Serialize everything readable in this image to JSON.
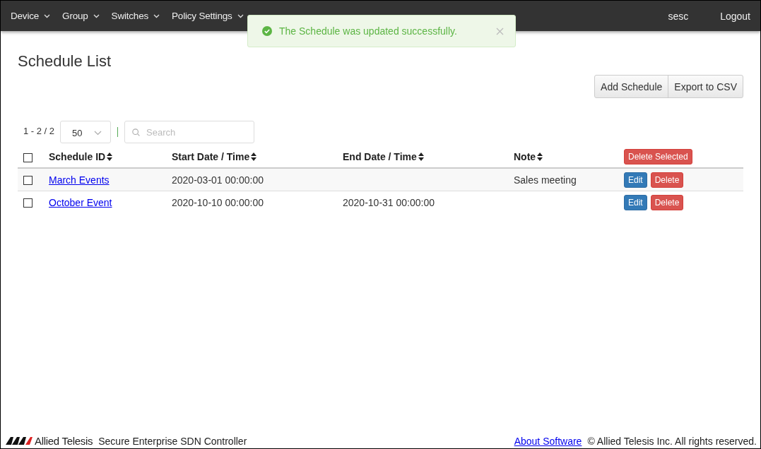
{
  "nav": {
    "items": [
      {
        "label": "Device"
      },
      {
        "label": "Group"
      },
      {
        "label": "Switches"
      },
      {
        "label": "Policy Settings"
      }
    ],
    "user": "sesc",
    "logout": "Logout"
  },
  "toast": {
    "message": "The Schedule was updated successfully."
  },
  "page": {
    "title": "Schedule List",
    "buttons": [
      "Add Schedule",
      "Export to CSV"
    ]
  },
  "pager": {
    "range": "1 - 2 / 2",
    "page_size": "50",
    "search_placeholder": "Search"
  },
  "table": {
    "columns": [
      "Schedule ID",
      "Start Date / Time",
      "End Date / Time",
      "Note"
    ],
    "delete_selected": "Delete Selected",
    "select_all_checked": false,
    "rows": [
      {
        "checked": false,
        "id": "March Events",
        "start": "2020-03-01 00:00:00",
        "end": "",
        "note": "Sales meeting",
        "edit": "Edit",
        "delete": "Delete"
      },
      {
        "checked": false,
        "id": "October Event",
        "start": "2020-10-10 00:00:00",
        "end": "2020-10-31 00:00:00",
        "note": "",
        "edit": "Edit",
        "delete": "Delete"
      }
    ]
  },
  "footer": {
    "brand": "Allied Telesis",
    "product": "Secure Enterprise SDN Controller",
    "about": "About Software",
    "copyright": "© Allied Telesis Inc. All rights reserved."
  }
}
